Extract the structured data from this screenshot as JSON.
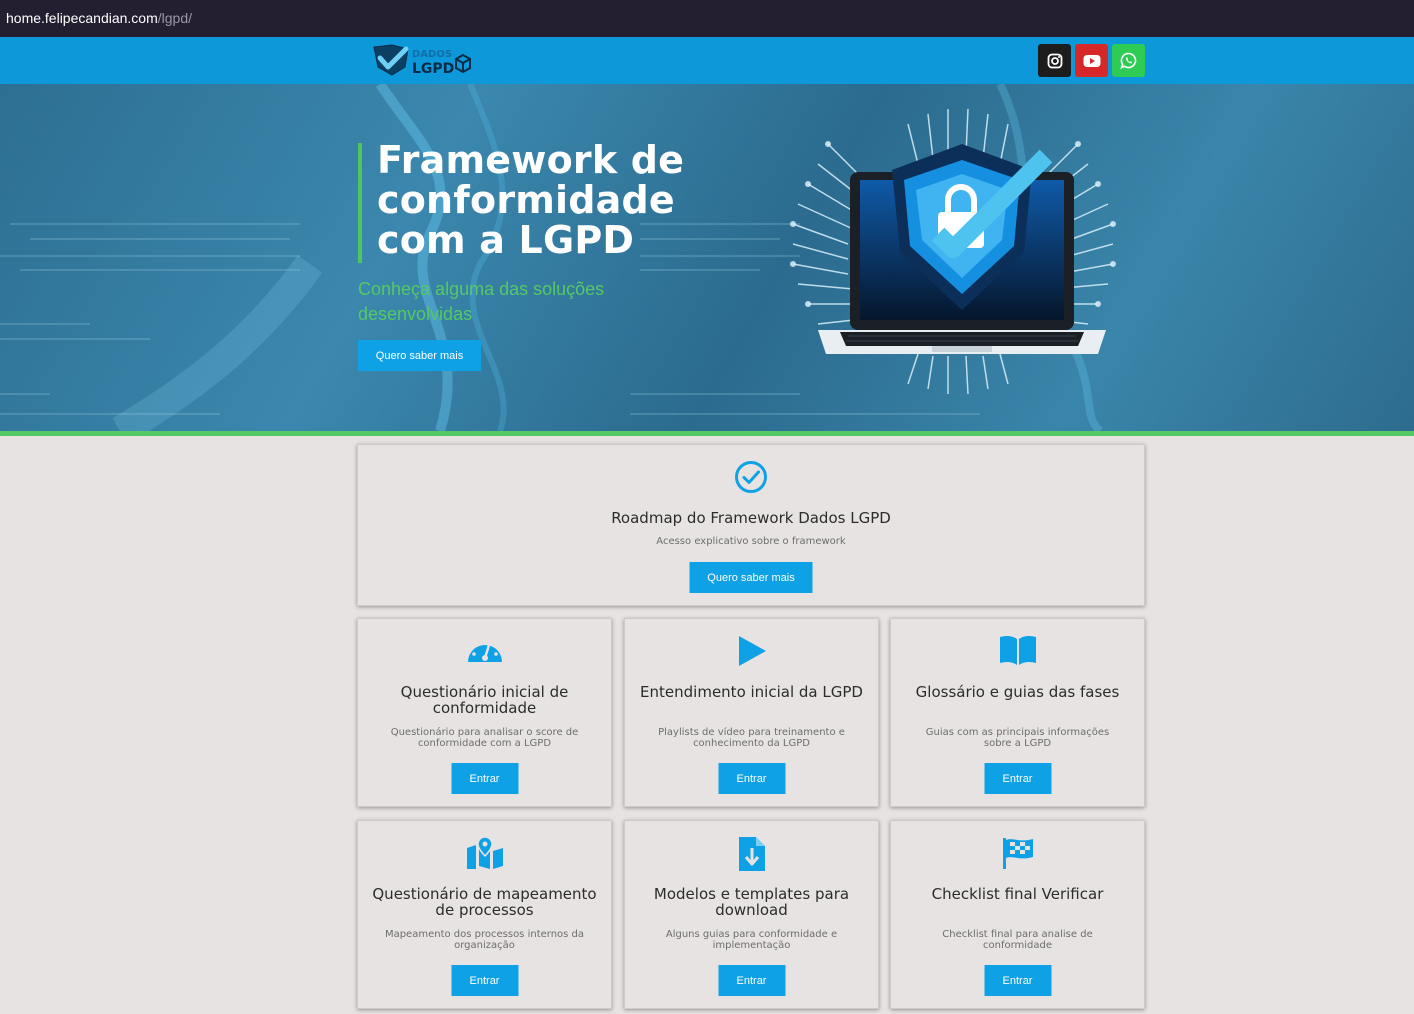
{
  "browser": {
    "url_host": "home.felipecandian.com",
    "url_path": "/lgpd/"
  },
  "navbar": {
    "logo_top": "DADOS",
    "logo_bottom": "LGPD",
    "social": [
      "instagram-icon",
      "youtube-icon",
      "whatsapp-icon"
    ]
  },
  "hero": {
    "title": "Framework de conformidade com a LGPD",
    "subtitle": "Conheça alguma das soluções desenvolvidas",
    "button_label": "Quero saber mais"
  },
  "main_card": {
    "title": "Roadmap do Framework Dados LGPD",
    "description": "Acesso explicativo sobre o framework",
    "button_label": "Quero saber mais",
    "icon": "check-circle-icon"
  },
  "cards": [
    {
      "title": "Questionário inicial de conformidade",
      "description": "Questionário para analisar o score de conformidade com a LGPD",
      "button_label": "Entrar",
      "icon": "speedometer-icon"
    },
    {
      "title": "Entendimento inicial da LGPD",
      "description": "Playlists de vídeo para treinamento e conhecimento da LGPD",
      "button_label": "Entrar",
      "icon": "play-icon"
    },
    {
      "title": "Glossário e guias das fases",
      "description": "Guias com as principais informações sobre a LGPD",
      "button_label": "Entrar",
      "icon": "book-icon"
    },
    {
      "title": "Questionário de mapeamento de processos",
      "description": "Mapeamento dos processos internos da organização",
      "button_label": "Entrar",
      "icon": "map-marker-icon"
    },
    {
      "title": "Modelos e templates para download",
      "description": "Alguns guias para conformidade e implementação",
      "button_label": "Entrar",
      "icon": "file-download-icon"
    },
    {
      "title": "Checklist final Verificar",
      "description": "Checklist final para analise de conformidade",
      "button_label": "Entrar",
      "icon": "checkered-flag-icon"
    }
  ],
  "colors": {
    "navbar": "#0d98da",
    "accent_blue": "#0fa1e6",
    "accent_green": "#56c865",
    "background": "#e7e3e2"
  }
}
